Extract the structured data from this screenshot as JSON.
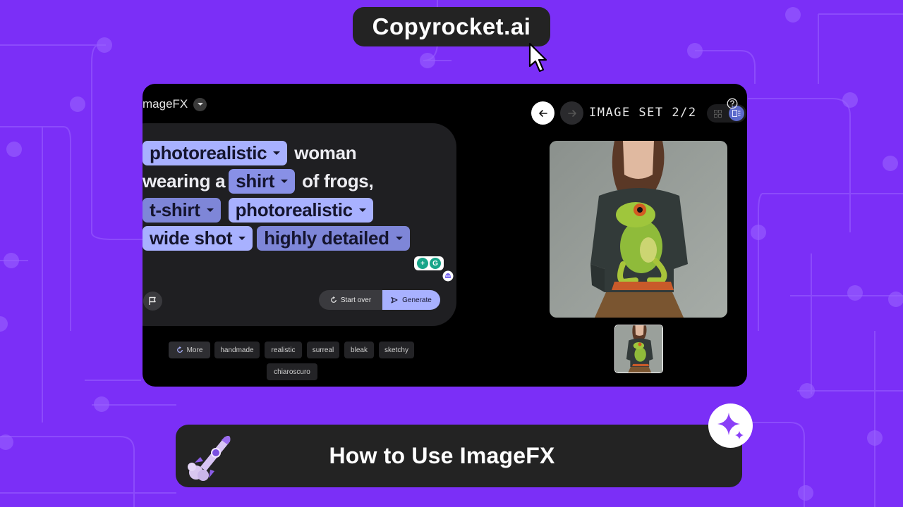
{
  "brand": {
    "name": "Copyrocket.ai"
  },
  "app": {
    "title": "mageFX",
    "prompt": {
      "lines": [
        [
          {
            "type": "chip",
            "text": "photorealistic",
            "shade": "light"
          },
          {
            "type": "word",
            "text": "woman"
          }
        ],
        [
          {
            "type": "word",
            "text": "wearing a"
          },
          {
            "type": "chip",
            "text": "shirt",
            "shade": "mid"
          },
          {
            "type": "word",
            "text": "of frogs,"
          }
        ],
        [
          {
            "type": "chip",
            "text": "t-shirt",
            "shade": "dark"
          },
          {
            "type": "chip",
            "text": "photorealistic",
            "shade": "light"
          }
        ],
        [
          {
            "type": "chip",
            "text": "wide shot",
            "shade": "light"
          },
          {
            "type": "chip",
            "text": "highly detailed",
            "shade": "dark"
          }
        ]
      ]
    },
    "actions": {
      "start_over": "Start over",
      "generate": "Generate"
    },
    "suggestions": {
      "more_label": "More",
      "tags": [
        "handmade",
        "realistic",
        "surreal",
        "bleak",
        "sketchy",
        "chiaroscuro"
      ]
    },
    "image_set": {
      "label": "IMAGE SET 2/2"
    }
  },
  "banner": {
    "title": "How to Use ImageFX"
  },
  "colors": {
    "background": "#7b2ff7",
    "chip_light": "#a8b1ff",
    "chip_dark": "#7e86d8",
    "panel": "#1f1f22",
    "banner": "#232323"
  },
  "icons": [
    "cursor-icon",
    "chevron-down-icon",
    "flag-icon",
    "reset-icon",
    "generate-icon",
    "refresh-icon",
    "arrow-left-icon",
    "arrow-right-icon",
    "help-icon",
    "grid-view-icon",
    "single-view-icon",
    "rocket-icon",
    "sparkle-icon"
  ]
}
